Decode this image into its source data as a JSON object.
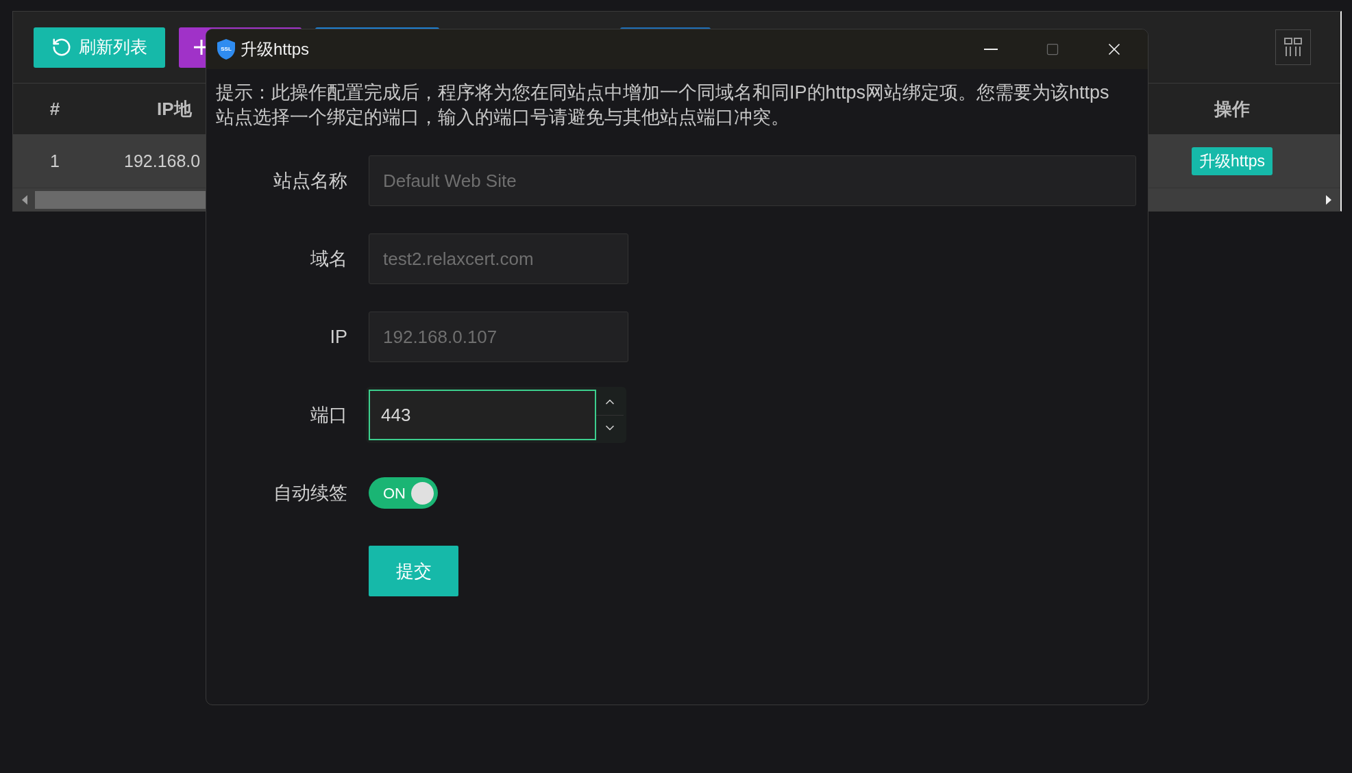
{
  "toolbar": {
    "buttons": [
      {
        "kind": "refresh",
        "label": "刷新列表",
        "color": "#16b9a9"
      },
      {
        "kind": "add",
        "color": "#a032c8"
      }
    ]
  },
  "table": {
    "columns": [
      "#",
      "IP地",
      "操作"
    ],
    "rows": [
      {
        "cells": [
          "1",
          "192.168.0"
        ],
        "action": "升级https"
      }
    ]
  },
  "dialog": {
    "title": "升级https",
    "logo_text": "SSL",
    "hint": "提示：此操作配置完成后，程序将为您在同站点中增加一个同域名和同IP的https网站绑定项。您需要为该https站点选择一个绑定的端口，输入的端口号请避免与其他站点端口冲突。",
    "fields": [
      {
        "kind": "text",
        "label": "站点名称",
        "value": "Default Web Site",
        "disabled": true,
        "focused": false
      },
      {
        "kind": "text",
        "label": "域名",
        "value": "test2.relaxcert.com",
        "disabled": true,
        "focused": false
      },
      {
        "kind": "text",
        "label": "IP",
        "value": "192.168.0.107",
        "disabled": true,
        "focused": false
      },
      {
        "kind": "number",
        "label": "端口",
        "value": "443",
        "disabled": false,
        "focused": true
      }
    ],
    "toggle": {
      "label": "自动续签",
      "text": "ON",
      "on": true
    },
    "submit": "提交"
  }
}
